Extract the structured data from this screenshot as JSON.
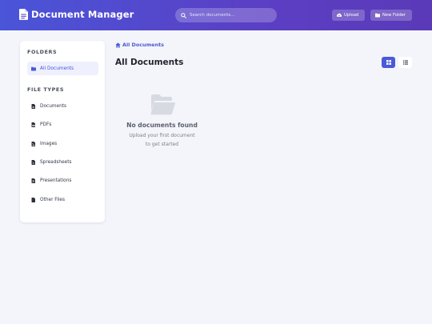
{
  "app": {
    "title": "Document Manager",
    "icon": "document-icon"
  },
  "search": {
    "placeholder": "Search documents...",
    "value": ""
  },
  "header_actions": {
    "upload_label": "Upload",
    "new_folder_label": "New Folder"
  },
  "sidebar": {
    "folders_title": "FOLDERS",
    "folders": [
      {
        "label": "All Documents",
        "icon": "folder-icon",
        "active": true
      }
    ],
    "file_types_title": "FILE TYPES",
    "file_types": [
      {
        "label": "Documents",
        "icon": "file-doc-icon"
      },
      {
        "label": "PDFs",
        "icon": "file-pdf-icon"
      },
      {
        "label": "Images",
        "icon": "file-image-icon"
      },
      {
        "label": "Spreadsheets",
        "icon": "file-spreadsheet-icon"
      },
      {
        "label": "Presentations",
        "icon": "file-presentation-icon"
      },
      {
        "label": "Other Files",
        "icon": "file-icon"
      }
    ]
  },
  "main": {
    "breadcrumb": "All Documents",
    "title": "All Documents",
    "view_mode": "grid",
    "empty_state": {
      "title": "No documents found",
      "subtitle_line1": "Upload your first document",
      "subtitle_line2": "to get started"
    }
  },
  "colors": {
    "accent": "#4a5ad8",
    "header_gradient_start": "#4a55d8",
    "header_gradient_end": "#5a3ab8",
    "background": "#f4f5fa"
  }
}
